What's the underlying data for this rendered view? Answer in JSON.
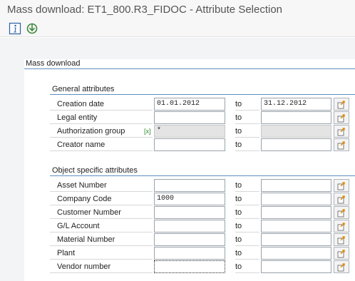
{
  "window": {
    "title": "Mass download: ET1_800.R3_FIDOC - Attribute Selection"
  },
  "toolbar": {
    "info_icon": "info-icon",
    "execute_icon": "execute-icon"
  },
  "mass_download": {
    "label": "Mass download"
  },
  "general": {
    "header": "General attributes",
    "rows": [
      {
        "label": "Creation date",
        "low": "01.01.2012",
        "to": "to",
        "high": "31.12.2012"
      },
      {
        "label": "Legal entity",
        "low": "",
        "to": "to",
        "high": ""
      },
      {
        "label": "Authorization group",
        "marker": "[x]",
        "low": "*",
        "to": "to",
        "high": ""
      },
      {
        "label": "Creator name",
        "low": "",
        "to": "to",
        "high": ""
      }
    ]
  },
  "object_specific": {
    "header": "Object specific attributes",
    "rows": [
      {
        "label": "Asset Number",
        "low": "",
        "to": "to",
        "high": ""
      },
      {
        "label": "Company Code",
        "low": "1000",
        "to": "to",
        "high": ""
      },
      {
        "label": "Customer Number",
        "low": "",
        "to": "to",
        "high": ""
      },
      {
        "label": "G/L Account",
        "low": "",
        "to": "to",
        "high": ""
      },
      {
        "label": "Material Number",
        "low": "",
        "to": "to",
        "high": ""
      },
      {
        "label": "Plant",
        "low": "",
        "to": "to",
        "high": ""
      },
      {
        "label": "Vendor number",
        "low": "",
        "to": "to",
        "high": ""
      }
    ]
  },
  "multiple_selection_icon": "multiple-selection-icon"
}
